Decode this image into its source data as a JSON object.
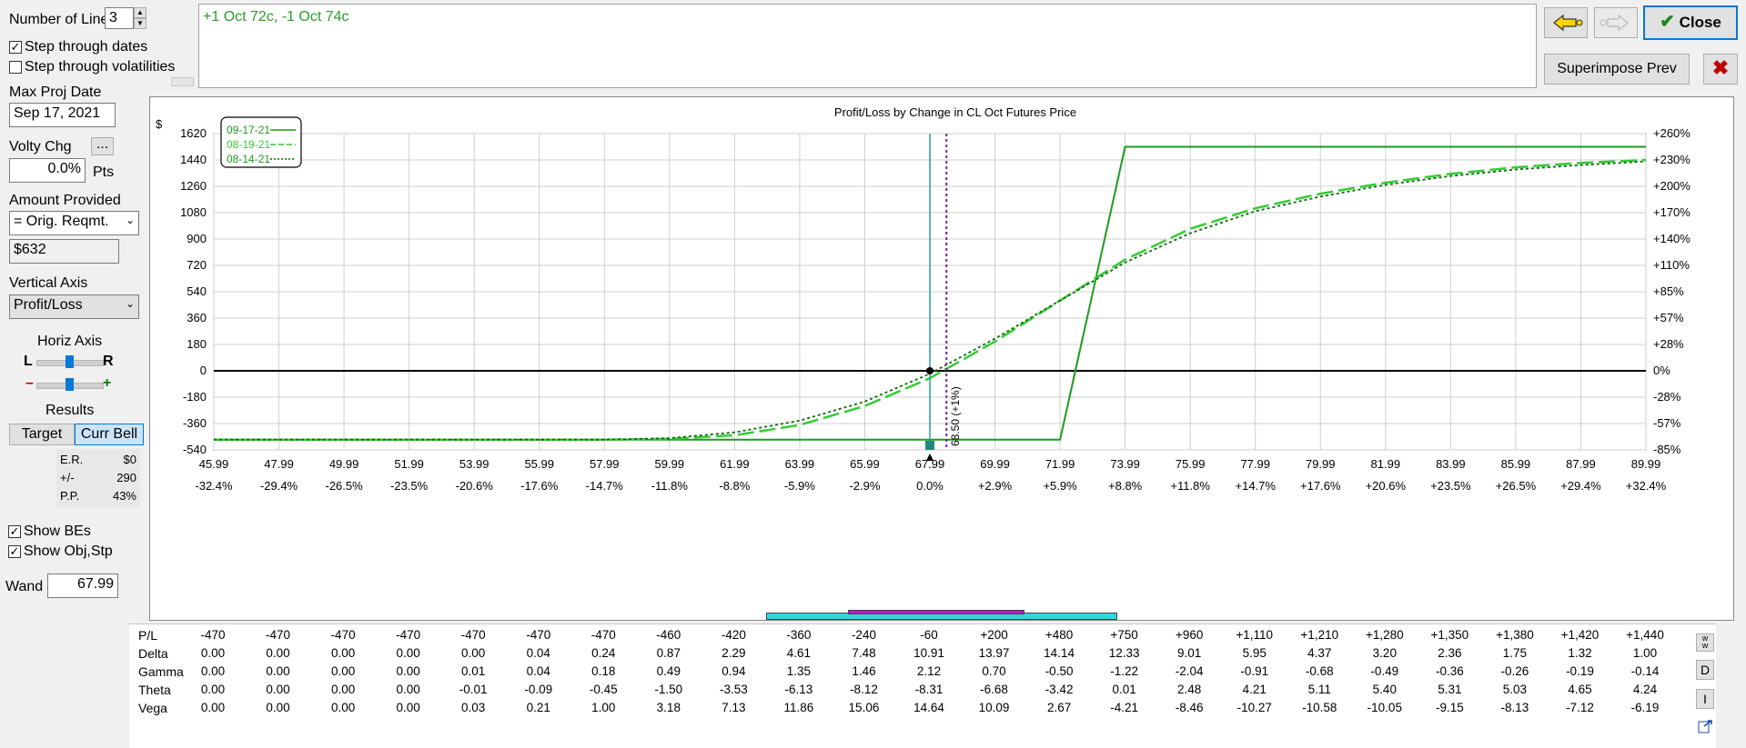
{
  "left_panel": {
    "number_of_lines_label": "Number of Lines",
    "number_of_lines_value": "3",
    "step_dates_label": "Step through dates",
    "step_dates_checked": true,
    "step_vols_label": "Step through volatilities",
    "step_vols_checked": false,
    "max_proj_date_label": "Max Proj Date",
    "max_proj_date_value": "Sep 17, 2021",
    "volty_chg_label": "Volty Chg",
    "volty_more_label": "...",
    "volty_value": "0.0%",
    "volty_unit": "Pts",
    "amount_provided_label": "Amount Provided",
    "amount_select_value": "= Orig. Reqmt.",
    "amount_value": "$632",
    "vertical_axis_label": "Vertical Axis",
    "vertical_axis_value": "Profit/Loss",
    "horiz_axis_label": "Horiz Axis",
    "horiz_left": "L",
    "horiz_right": "R",
    "zoom_minus": "–",
    "zoom_plus": "+",
    "results_label": "Results",
    "target_tab": "Target",
    "curr_bell_tab": "Curr Bell",
    "er_label": "E.R.",
    "er_value": "$0",
    "pm_label": "+/-",
    "pm_value": "290",
    "pp_label": "P.P.",
    "pp_value": "43%",
    "show_bes_label": "Show BEs",
    "show_bes_checked": true,
    "show_obj_label": "Show Obj,Stp",
    "show_obj_checked": true,
    "wand_label": "Wand",
    "wand_value": "67.99"
  },
  "position_text": "+1 Oct 72c, -1 Oct 74c",
  "top_right": {
    "close_label": "Close",
    "superimpose_label": "Superimpose Prev"
  },
  "colors": {
    "line_green": "#2a9d2a",
    "bright_green": "#33cc33",
    "purple": "#7a1fa2",
    "teal": "#2a9d8f"
  },
  "chart_data": {
    "type": "line",
    "title": "Profit/Loss by Change in CL Oct Futures Price",
    "ylabel": "$",
    "ylim": [
      -540,
      1620
    ],
    "xlim": [
      45.99,
      89.99
    ],
    "y_ticks": [
      1620,
      1440,
      1260,
      1080,
      900,
      720,
      540,
      360,
      180,
      0,
      -180,
      -360,
      -540
    ],
    "y2_ticks": [
      "+260%",
      "+230%",
      "+200%",
      "+170%",
      "+140%",
      "+110%",
      "+85%",
      "+57%",
      "+28%",
      "0%",
      "-28%",
      "-57%",
      "-85%"
    ],
    "x_ticks": [
      "45.99",
      "47.99",
      "49.99",
      "51.99",
      "53.99",
      "55.99",
      "57.99",
      "59.99",
      "61.99",
      "63.99",
      "65.99",
      "67.99",
      "69.99",
      "71.99",
      "73.99",
      "75.99",
      "77.99",
      "79.99",
      "81.99",
      "83.99",
      "85.99",
      "87.99",
      "89.99"
    ],
    "x_pct_ticks": [
      "-32.4%",
      "-29.4%",
      "-26.5%",
      "-23.5%",
      "-20.6%",
      "-17.6%",
      "-14.7%",
      "-11.8%",
      "-8.8%",
      "-5.9%",
      "-2.9%",
      "0.0%",
      "+2.9%",
      "+5.9%",
      "+8.8%",
      "+11.8%",
      "+14.7%",
      "+17.6%",
      "+20.6%",
      "+23.5%",
      "+26.5%",
      "+29.4%",
      "+32.4%"
    ],
    "current_price": 67.99,
    "marker_price": 68.5,
    "marker_label": "68.50 (+1%)",
    "series": [
      {
        "name": "09-17-21",
        "style": "solid",
        "x": [
          45.99,
          71.99,
          73.99,
          89.99
        ],
        "y": [
          -470,
          -470,
          1530,
          1530
        ]
      },
      {
        "name": "08-19-21",
        "style": "dash",
        "x": [
          45.99,
          57.99,
          59.99,
          61.99,
          63.99,
          65.99,
          67.99,
          69.99,
          71.99,
          73.99,
          75.99,
          77.99,
          79.99,
          81.99,
          83.99,
          85.99,
          87.99,
          89.99
        ],
        "y": [
          -470,
          -470,
          -465,
          -440,
          -370,
          -240,
          -50,
          200,
          480,
          760,
          970,
          1110,
          1210,
          1285,
          1345,
          1390,
          1420,
          1440
        ]
      },
      {
        "name": "08-14-21",
        "style": "dot",
        "x": [
          45.99,
          57.99,
          59.99,
          61.99,
          63.99,
          65.99,
          67.99,
          69.99,
          71.99,
          73.99,
          75.99,
          77.99,
          79.99,
          81.99,
          83.99,
          85.99,
          87.99,
          89.99
        ],
        "y": [
          -470,
          -470,
          -460,
          -420,
          -340,
          -210,
          -20,
          220,
          480,
          740,
          940,
          1090,
          1190,
          1270,
          1330,
          1375,
          1405,
          1430
        ]
      }
    ]
  },
  "greeks": {
    "labels": [
      "P/L",
      "Delta",
      "Gamma",
      "Theta",
      "Vega"
    ],
    "rows": [
      [
        "-470",
        "-470",
        "-470",
        "-470",
        "-470",
        "-470",
        "-470",
        "-460",
        "-420",
        "-360",
        "-240",
        "-60",
        "+200",
        "+480",
        "+750",
        "+960",
        "+1,110",
        "+1,210",
        "+1,280",
        "+1,350",
        "+1,380",
        "+1,420",
        "+1,440"
      ],
      [
        "0.00",
        "0.00",
        "0.00",
        "0.00",
        "0.00",
        "0.04",
        "0.24",
        "0.87",
        "2.29",
        "4.61",
        "7.48",
        "10.91",
        "13.97",
        "14.14",
        "12.33",
        "9.01",
        "5.95",
        "4.37",
        "3.20",
        "2.36",
        "1.75",
        "1.32",
        "1.00"
      ],
      [
        "0.00",
        "0.00",
        "0.00",
        "0.00",
        "0.01",
        "0.04",
        "0.18",
        "0.49",
        "0.94",
        "1.35",
        "1.46",
        "2.12",
        "0.70",
        "-0.50",
        "-1.22",
        "-2.04",
        "-0.91",
        "-0.68",
        "-0.49",
        "-0.36",
        "-0.26",
        "-0.19",
        "-0.14"
      ],
      [
        "0.00",
        "0.00",
        "0.00",
        "0.00",
        "-0.01",
        "-0.09",
        "-0.45",
        "-1.50",
        "-3.53",
        "-6.13",
        "-8.12",
        "-8.31",
        "-6.68",
        "-3.42",
        "0.01",
        "2.48",
        "4.21",
        "5.11",
        "5.40",
        "5.31",
        "5.03",
        "4.65",
        "4.24"
      ],
      [
        "0.00",
        "0.00",
        "0.00",
        "0.00",
        "0.03",
        "0.21",
        "1.00",
        "3.18",
        "7.13",
        "11.86",
        "15.06",
        "14.64",
        "10.09",
        "2.67",
        "-4.21",
        "-8.46",
        "-10.27",
        "-10.58",
        "-10.05",
        "-9.15",
        "-8.13",
        "-7.12",
        "-6.19"
      ]
    ]
  },
  "side_buttons": {
    "w_label": "w",
    "d_label": "D",
    "i_label": "I"
  }
}
